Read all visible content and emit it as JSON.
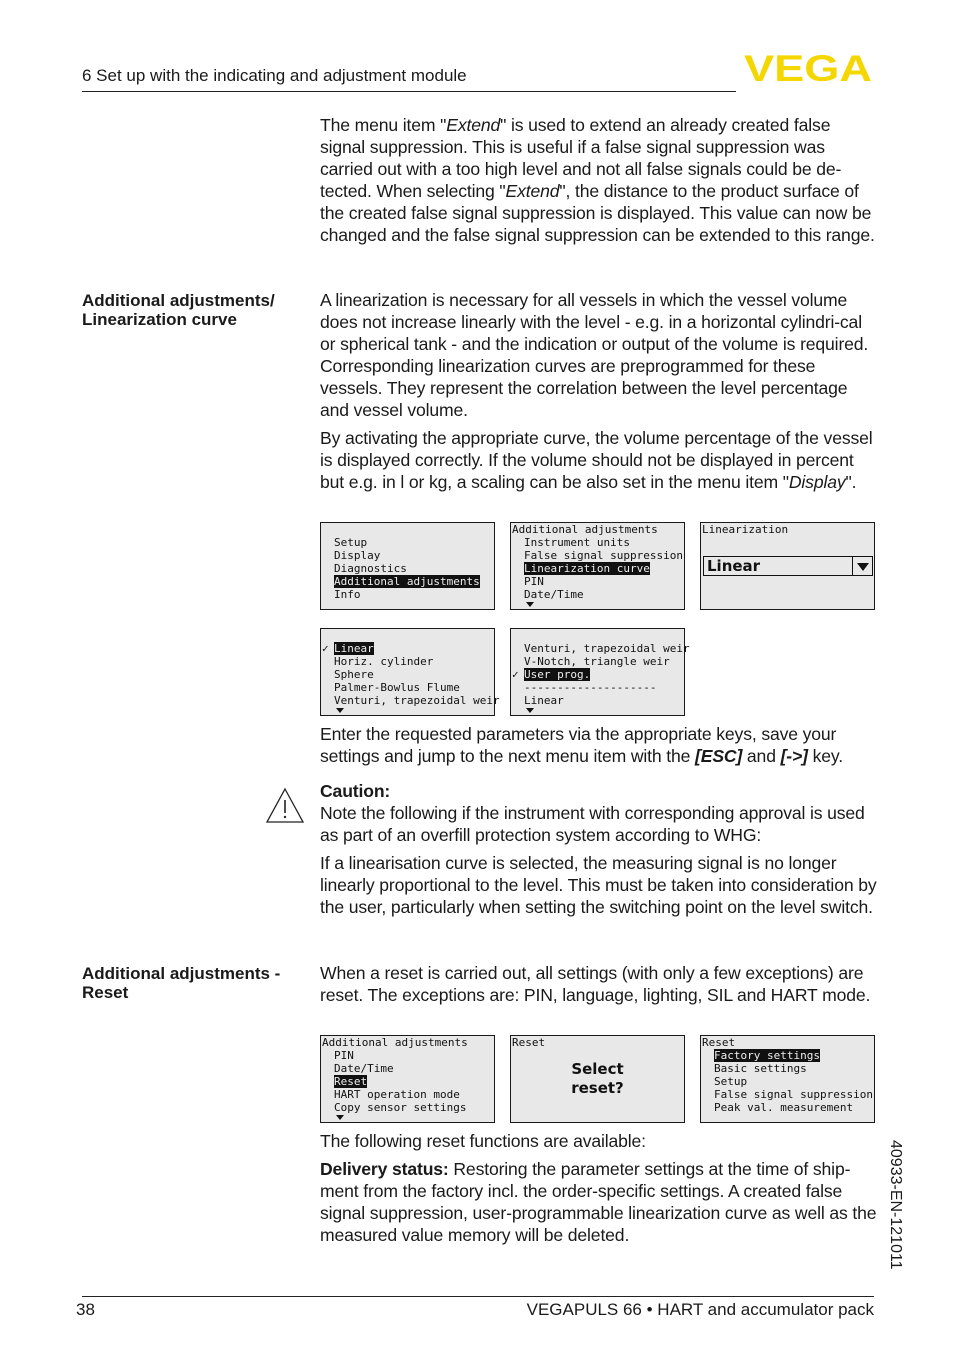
{
  "header": {
    "section_title": "6 Set up with the indicating and adjustment module",
    "logo_text": "VEGA",
    "logo_color": "#f4d600"
  },
  "intro": {
    "p1_a": "The menu item \"",
    "p1_em1": "Extend",
    "p1_b": "\" is used to extend an already created false signal suppression. This is useful if a false signal suppression was carried out with a too high level and not all false signals could be de-tected. When selecting \"",
    "p1_em2": "Extend",
    "p1_c": "\", the distance to the product surface of the created false signal suppression is displayed. This value can now be changed and the false signal suppression can be extended to this range."
  },
  "linearization": {
    "side_label": "Additional adjustments/ Linearization curve",
    "p1": "A linearization is necessary for all vessels in which the vessel volume does not increase linearly with the level - e.g. in a horizontal cylindri-cal or spherical tank - and the indication or output of the volume is required. Corresponding linearization curves are preprogrammed for these vessels. They represent the correlation between the level percentage and vessel volume.",
    "p2_a": "By activating the appropriate curve, the volume percentage of the vessel is displayed correctly. If the volume should not be displayed in percent but e.g. in l or kg, a scaling can be also set in the menu item \"",
    "p2_em": "Display",
    "p2_b": "\".",
    "screens": {
      "main_menu": [
        "Setup",
        "Display",
        "Diagnostics",
        "Additional adjustments",
        "Info"
      ],
      "main_menu_selected": "Additional adjustments",
      "add_adj_title": "Additional adjustments",
      "add_adj_items": [
        "Instrument units",
        "False signal suppression",
        "Linearization curve",
        "PIN",
        "Date/Time"
      ],
      "add_adj_selected": "Linearization curve",
      "lin_title": "Linearization",
      "lin_value": "Linear",
      "list1": [
        "Linear",
        "Horiz. cylinder",
        "Sphere",
        "Palmer-Bowlus Flume",
        "Venturi, trapezoidal weir"
      ],
      "list1_checked": "Linear",
      "list2": [
        "Venturi, trapezoidal weir",
        "V-Notch, triangle weir",
        "User prog.",
        "--------------------",
        "Linear"
      ],
      "list2_checked": "User prog."
    },
    "enter_a": "Enter the requested parameters via the appropriate keys, save your settings and jump to the next menu item with the ",
    "enter_key1": "[ESC]",
    "enter_and": " and ",
    "enter_key2": "[->]",
    "enter_b": " key.",
    "caution_title": "Caution:",
    "caution_p1": "Note the following if the instrument with corresponding approval is used as part of an overfill protection system according to WHG:",
    "caution_p2": "If a linearisation curve is selected, the measuring signal is no longer linearly proportional to the level. This must be taken into consideration by the user, particularly when setting the switching point on the level switch."
  },
  "reset": {
    "side_label": "Additional adjustments - Reset",
    "p1": "When a reset is carried out, all settings (with only a few exceptions) are reset. The exceptions are: PIN, language, lighting, SIL and HART mode.",
    "screens": {
      "add_adj_title": "Additional adjustments",
      "add_adj_items": [
        "PIN",
        "Date/Time",
        "Reset",
        "HART operation mode",
        "Copy sensor settings"
      ],
      "add_adj_selected": "Reset",
      "confirm_title": "Reset",
      "confirm_line1": "Select",
      "confirm_line2": "reset?",
      "options_title": "Reset",
      "options": [
        "Factory settings",
        "Basic settings",
        "Setup",
        "False signal suppression",
        "Peak val. measurement"
      ],
      "options_selected": "Factory settings"
    },
    "functions_intro": "The following reset functions are available:",
    "delivery_label": "Delivery status:",
    "delivery_text": " Restoring the parameter settings at the time of ship-ment from the factory incl. the order-specific settings. A created false signal suppression, user-programmable linearization curve as well as the measured value memory will be deleted."
  },
  "footer": {
    "page_number": "38",
    "doc_title": "VEGAPULS 66 • HART and accumulator pack",
    "doc_id": "40933-EN-121011"
  }
}
